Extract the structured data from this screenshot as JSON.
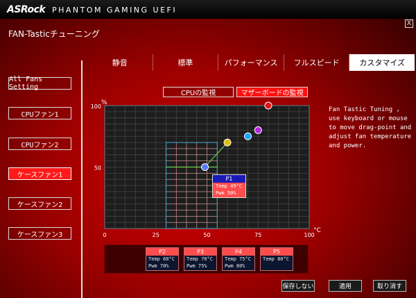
{
  "header": {
    "brand": "ASRock",
    "subtitle": "PHANTOM GAMING UEFI",
    "close_label": "X"
  },
  "page_title": "FAN-Tasticチューニング",
  "tabs": [
    {
      "label": "静音",
      "active": false
    },
    {
      "label": "標準",
      "active": false
    },
    {
      "label": "パフォーマンス",
      "active": false
    },
    {
      "label": "フルスピード",
      "active": false
    },
    {
      "label": "カスタマイズ",
      "active": true
    }
  ],
  "sidebar": {
    "items": [
      {
        "label": "All Fans Setting",
        "active": false
      },
      {
        "label": "CPUファン1",
        "active": false
      },
      {
        "label": "CPUファン2",
        "active": false
      },
      {
        "label": "ケースファン1",
        "active": true
      },
      {
        "label": "ケースファン2",
        "active": false
      },
      {
        "label": "ケースファン3",
        "active": false
      }
    ]
  },
  "monitor": {
    "cpu_label": "CPUの監視",
    "mb_label": "マザーボードの監視"
  },
  "help_text": "Fan Tastic Tuning , use keyboard or mouse to move drag-point and adjust fan temperature and power.",
  "chart_data": {
    "type": "scatter",
    "xlabel": "°C",
    "ylabel": "%",
    "xlim": [
      0,
      100
    ],
    "ylim": [
      0,
      100
    ],
    "x_ticks": [
      "0",
      "25",
      "50",
      "75",
      "100"
    ],
    "y_ticks": [
      "50",
      "100"
    ],
    "grid": true,
    "points": [
      {
        "name": "P1",
        "x": 49,
        "y": 50,
        "color": "#5a78ff"
      },
      {
        "name": "P2",
        "x": 60,
        "y": 70,
        "color": "#e0c000"
      },
      {
        "name": "P3",
        "x": 70,
        "y": 75,
        "color": "#1aa3ff"
      },
      {
        "name": "P4",
        "x": 75,
        "y": 80,
        "color": "#b428e0"
      },
      {
        "name": "P5",
        "x": 80,
        "y": 100,
        "color": "#e01414"
      }
    ]
  },
  "tooltip": {
    "name": "P1",
    "temp": "Temp 49°C",
    "pwm": "Pwm  50%"
  },
  "points_bar": [
    {
      "name": "P2",
      "temp": "Temp 60°C",
      "pwm": "Pwm  70%"
    },
    {
      "name": "P3",
      "temp": "Temp 70°C",
      "pwm": "Pwm  75%"
    },
    {
      "name": "P4",
      "temp": "Temp 75°C",
      "pwm": "Pwm  80%"
    },
    {
      "name": "P5",
      "temp": "Temp 80°C",
      "pwm": ""
    }
  ],
  "actions": {
    "discard": "保存しない",
    "apply": "適用",
    "cancel": "取り消す"
  }
}
